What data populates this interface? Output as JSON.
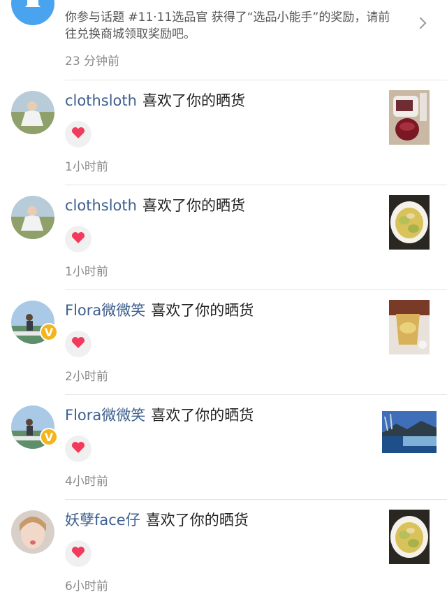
{
  "system_notice": {
    "text": "你参与话题 #11·11选品官 获得了“选品小能手”的奖励，请前往兑换商城领取奖励吧。",
    "time": "23 分钟前",
    "icon": "bell-icon"
  },
  "action_text": "喜欢了你的晒货",
  "notifications": [
    {
      "username": "clothsloth",
      "action": "喜欢了你的晒货",
      "time": "1小时前",
      "verified": false
    },
    {
      "username": "clothsloth",
      "action": "喜欢了你的晒货",
      "time": "1小时前",
      "verified": false
    },
    {
      "username": "Flora微微笑",
      "action": "喜欢了你的晒货",
      "time": "2小时前",
      "verified": true
    },
    {
      "username": "Flora微微笑",
      "action": "喜欢了你的晒货",
      "time": "4小时前",
      "verified": true
    },
    {
      "username": "妖孽face仔",
      "action": "喜欢了你的晒货",
      "time": "6小时前",
      "verified": false
    }
  ],
  "colors": {
    "username": "#3d5f8f",
    "heart": "#f23a5c",
    "badge": "#f3b51c",
    "bell_bg": "#4aa3ee"
  }
}
